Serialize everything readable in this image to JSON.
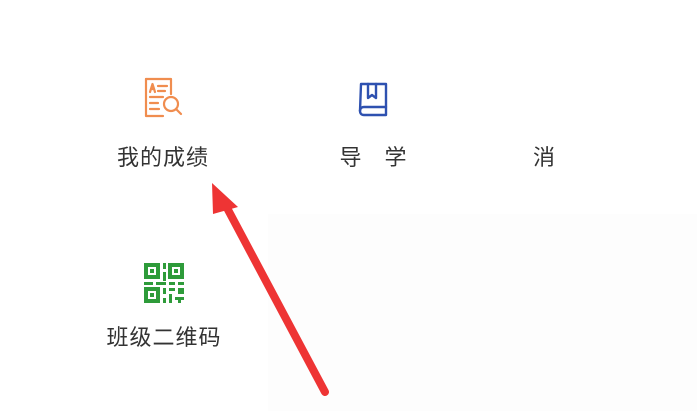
{
  "menu": {
    "items": [
      {
        "label": "我的成绩",
        "icon": "grade-report-icon",
        "icon_color": "#f08d4f"
      },
      {
        "label": "导 学",
        "icon": "book-icon",
        "icon_color": "#2e51b0"
      },
      {
        "label": "消",
        "icon": "",
        "icon_color": ""
      },
      {
        "label": "班级二维码",
        "icon": "qr-code-icon",
        "icon_color": "#2e9b3a"
      }
    ]
  },
  "annotation": {
    "type": "arrow",
    "color": "#ee3434",
    "points_to": "我的成绩"
  }
}
